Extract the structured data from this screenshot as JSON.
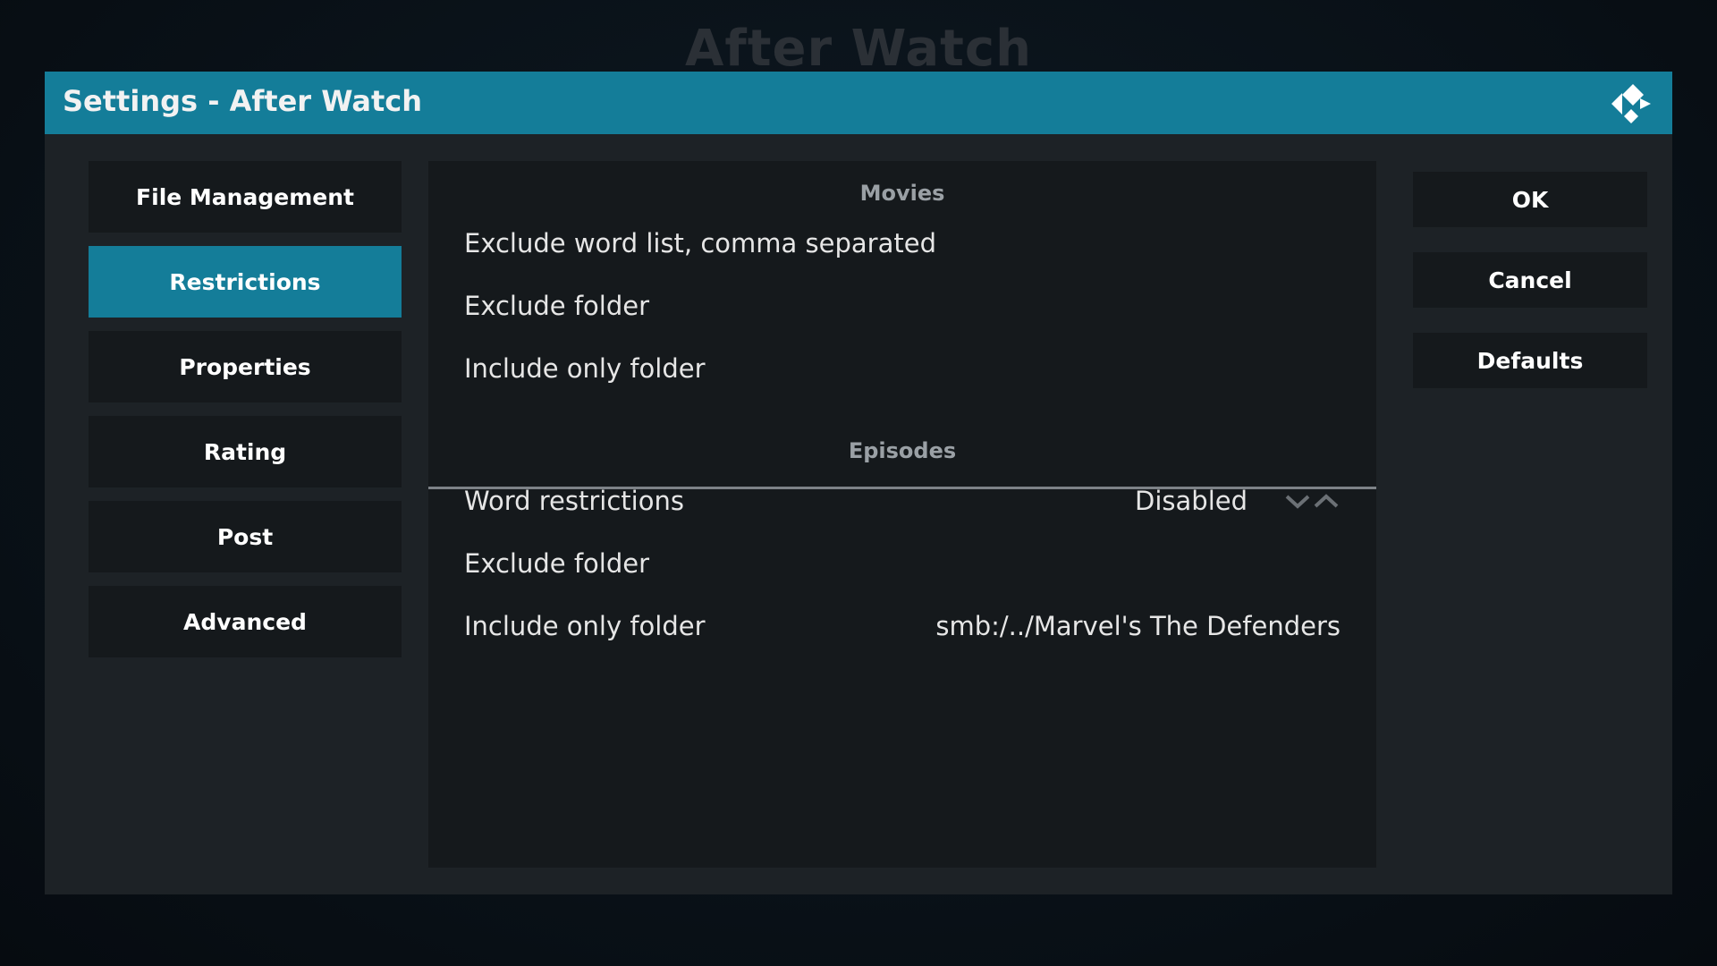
{
  "background_title": "After Watch",
  "dialog": {
    "title": "Settings - After Watch",
    "logo_icon": "kodi-logo-icon"
  },
  "categories": [
    {
      "label": "File Management",
      "active": false
    },
    {
      "label": "Restrictions",
      "active": true
    },
    {
      "label": "Properties",
      "active": false
    },
    {
      "label": "Rating",
      "active": false
    },
    {
      "label": "Post",
      "active": false
    },
    {
      "label": "Advanced",
      "active": false
    }
  ],
  "movies": {
    "header": "Movies",
    "settings": [
      {
        "label": "Exclude word list, comma separated",
        "value": ""
      },
      {
        "label": "Exclude folder",
        "value": ""
      },
      {
        "label": "Include only folder",
        "value": ""
      }
    ]
  },
  "episodes": {
    "header": "Episodes",
    "settings": [
      {
        "label": "Word restrictions",
        "value": "Disabled"
      },
      {
        "label": "Exclude folder",
        "value": ""
      },
      {
        "label": "Include only folder",
        "value": "smb:/../Marvel's The Defenders"
      }
    ]
  },
  "buttons": {
    "ok": "OK",
    "cancel": "Cancel",
    "defaults": "Defaults"
  },
  "colors": {
    "accent": "#147d99",
    "dialog_bg": "#1d2226",
    "panel_bg": "#15191c"
  }
}
